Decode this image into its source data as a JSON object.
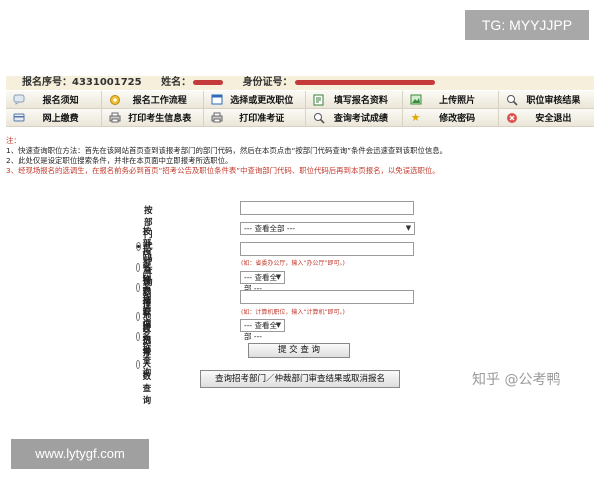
{
  "watermarks": {
    "top": "TG: MYYJJPP",
    "zhihu": "知乎 @公考鸭",
    "bottom": "www.lytygf.com"
  },
  "info": {
    "reg_no_label": "报名序号：",
    "reg_no": "4331001725",
    "name_label": "姓名：",
    "id_label": "身份证号："
  },
  "nav": {
    "items": [
      {
        "label": "报名须知",
        "icon": "chat-bubble-icon"
      },
      {
        "label": "报名工作流程",
        "icon": "gear-icon"
      },
      {
        "label": "选择或更改职位",
        "icon": "window-icon"
      },
      {
        "label": "填写报名资料",
        "icon": "edit-form-icon"
      },
      {
        "label": "上传照片",
        "icon": "photo-icon"
      },
      {
        "label": "职位审核结果",
        "icon": "magnifier-icon"
      },
      {
        "label": "网上缴费",
        "icon": "payment-card-icon"
      },
      {
        "label": "打印考生信息表",
        "icon": "printer-icon"
      },
      {
        "label": "打印准考证",
        "icon": "printer-icon"
      },
      {
        "label": "查询考试成绩",
        "icon": "magnifier-icon"
      },
      {
        "label": "修改密码",
        "icon": "star-icon"
      },
      {
        "label": "安全退出",
        "icon": "exit-icon"
      }
    ],
    "colors": {
      "accent_red": "#c0392b",
      "bar_bg": "#f6efdc"
    }
  },
  "notes": {
    "heading": "注：",
    "line1": "1、快速查询职位方法：首先在该网站首页查到该报考部门的部门代码，然后在本页点击“按部门代码查询”条件会迅速查到该职位信息。",
    "line2": "2、此处仅是设定职位搜索条件，并非在本页面中立即报考所选职位。",
    "line3": "3、经现场报名的选调生，在报名前务必到首页“招考公告及职位条件表”中查询部门代码、职位代码后再到本页报名，以免误选职位。"
  },
  "form": {
    "dept_code": {
      "label": "按部门代码查询",
      "value": "",
      "checked": true
    },
    "dept_select": {
      "label": "按部门名称选择",
      "selected": "--- 查看全部 ---"
    },
    "dept_name": {
      "label": "按部门名称查询",
      "value": "",
      "hint": "(如：省委办公厅，输入“办公厅”即可。)"
    },
    "region": {
      "label": "按职位地区选择",
      "selected": "--- 查看全部 ---"
    },
    "pos_name": {
      "label": "按职位名称查询",
      "value": "",
      "hint": "(如：计算机职位，输入“计算机”即可。)"
    },
    "applicants": {
      "label": "按招考人数查询",
      "selected": "--- 查看全部 ---"
    },
    "submit_label": "提 交 查 询",
    "query_review_label": "查询招考部门／仲裁部门审查结果或取消报名"
  }
}
